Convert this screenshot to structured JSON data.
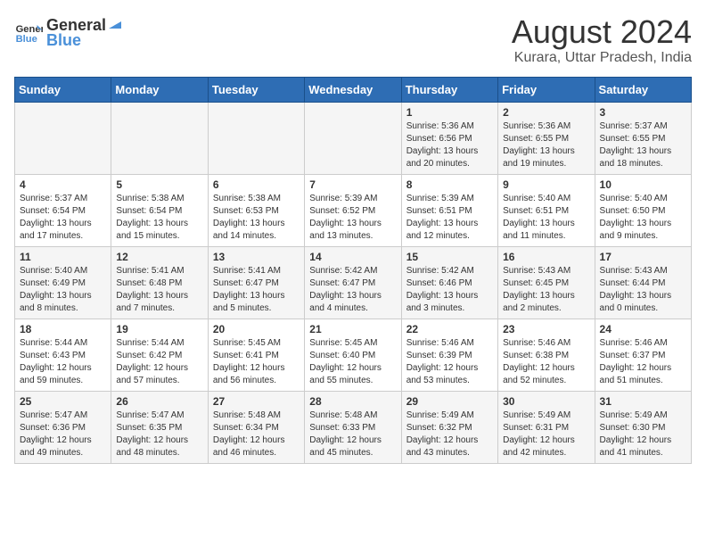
{
  "header": {
    "logo_general": "General",
    "logo_blue": "Blue",
    "month": "August 2024",
    "location": "Kurara, Uttar Pradesh, India"
  },
  "days_of_week": [
    "Sunday",
    "Monday",
    "Tuesday",
    "Wednesday",
    "Thursday",
    "Friday",
    "Saturday"
  ],
  "weeks": [
    [
      {
        "day": "",
        "info": ""
      },
      {
        "day": "",
        "info": ""
      },
      {
        "day": "",
        "info": ""
      },
      {
        "day": "",
        "info": ""
      },
      {
        "day": "1",
        "info": "Sunrise: 5:36 AM\nSunset: 6:56 PM\nDaylight: 13 hours and 20 minutes."
      },
      {
        "day": "2",
        "info": "Sunrise: 5:36 AM\nSunset: 6:55 PM\nDaylight: 13 hours and 19 minutes."
      },
      {
        "day": "3",
        "info": "Sunrise: 5:37 AM\nSunset: 6:55 PM\nDaylight: 13 hours and 18 minutes."
      }
    ],
    [
      {
        "day": "4",
        "info": "Sunrise: 5:37 AM\nSunset: 6:54 PM\nDaylight: 13 hours and 17 minutes."
      },
      {
        "day": "5",
        "info": "Sunrise: 5:38 AM\nSunset: 6:54 PM\nDaylight: 13 hours and 15 minutes."
      },
      {
        "day": "6",
        "info": "Sunrise: 5:38 AM\nSunset: 6:53 PM\nDaylight: 13 hours and 14 minutes."
      },
      {
        "day": "7",
        "info": "Sunrise: 5:39 AM\nSunset: 6:52 PM\nDaylight: 13 hours and 13 minutes."
      },
      {
        "day": "8",
        "info": "Sunrise: 5:39 AM\nSunset: 6:51 PM\nDaylight: 13 hours and 12 minutes."
      },
      {
        "day": "9",
        "info": "Sunrise: 5:40 AM\nSunset: 6:51 PM\nDaylight: 13 hours and 11 minutes."
      },
      {
        "day": "10",
        "info": "Sunrise: 5:40 AM\nSunset: 6:50 PM\nDaylight: 13 hours and 9 minutes."
      }
    ],
    [
      {
        "day": "11",
        "info": "Sunrise: 5:40 AM\nSunset: 6:49 PM\nDaylight: 13 hours and 8 minutes."
      },
      {
        "day": "12",
        "info": "Sunrise: 5:41 AM\nSunset: 6:48 PM\nDaylight: 13 hours and 7 minutes."
      },
      {
        "day": "13",
        "info": "Sunrise: 5:41 AM\nSunset: 6:47 PM\nDaylight: 13 hours and 5 minutes."
      },
      {
        "day": "14",
        "info": "Sunrise: 5:42 AM\nSunset: 6:47 PM\nDaylight: 13 hours and 4 minutes."
      },
      {
        "day": "15",
        "info": "Sunrise: 5:42 AM\nSunset: 6:46 PM\nDaylight: 13 hours and 3 minutes."
      },
      {
        "day": "16",
        "info": "Sunrise: 5:43 AM\nSunset: 6:45 PM\nDaylight: 13 hours and 2 minutes."
      },
      {
        "day": "17",
        "info": "Sunrise: 5:43 AM\nSunset: 6:44 PM\nDaylight: 13 hours and 0 minutes."
      }
    ],
    [
      {
        "day": "18",
        "info": "Sunrise: 5:44 AM\nSunset: 6:43 PM\nDaylight: 12 hours and 59 minutes."
      },
      {
        "day": "19",
        "info": "Sunrise: 5:44 AM\nSunset: 6:42 PM\nDaylight: 12 hours and 57 minutes."
      },
      {
        "day": "20",
        "info": "Sunrise: 5:45 AM\nSunset: 6:41 PM\nDaylight: 12 hours and 56 minutes."
      },
      {
        "day": "21",
        "info": "Sunrise: 5:45 AM\nSunset: 6:40 PM\nDaylight: 12 hours and 55 minutes."
      },
      {
        "day": "22",
        "info": "Sunrise: 5:46 AM\nSunset: 6:39 PM\nDaylight: 12 hours and 53 minutes."
      },
      {
        "day": "23",
        "info": "Sunrise: 5:46 AM\nSunset: 6:38 PM\nDaylight: 12 hours and 52 minutes."
      },
      {
        "day": "24",
        "info": "Sunrise: 5:46 AM\nSunset: 6:37 PM\nDaylight: 12 hours and 51 minutes."
      }
    ],
    [
      {
        "day": "25",
        "info": "Sunrise: 5:47 AM\nSunset: 6:36 PM\nDaylight: 12 hours and 49 minutes."
      },
      {
        "day": "26",
        "info": "Sunrise: 5:47 AM\nSunset: 6:35 PM\nDaylight: 12 hours and 48 minutes."
      },
      {
        "day": "27",
        "info": "Sunrise: 5:48 AM\nSunset: 6:34 PM\nDaylight: 12 hours and 46 minutes."
      },
      {
        "day": "28",
        "info": "Sunrise: 5:48 AM\nSunset: 6:33 PM\nDaylight: 12 hours and 45 minutes."
      },
      {
        "day": "29",
        "info": "Sunrise: 5:49 AM\nSunset: 6:32 PM\nDaylight: 12 hours and 43 minutes."
      },
      {
        "day": "30",
        "info": "Sunrise: 5:49 AM\nSunset: 6:31 PM\nDaylight: 12 hours and 42 minutes."
      },
      {
        "day": "31",
        "info": "Sunrise: 5:49 AM\nSunset: 6:30 PM\nDaylight: 12 hours and 41 minutes."
      }
    ]
  ]
}
